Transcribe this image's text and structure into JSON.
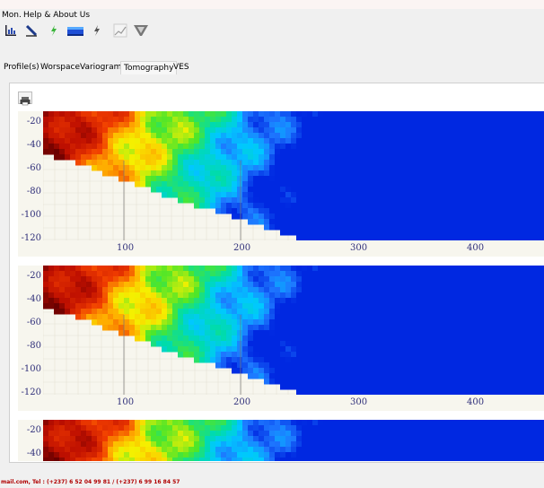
{
  "menu": {
    "items": [
      "Mon.",
      "Help & About Us"
    ]
  },
  "toolbar": {
    "icons": [
      "bar-chart-icon",
      "ruler-icon",
      "lightning-green-icon",
      "block-model-icon",
      "lightning-icon",
      "line-graph-icon",
      "funnel-icon"
    ]
  },
  "tabs": [
    "Profile(s)",
    "Worspace",
    "Variograms",
    "Tomography",
    "VES"
  ],
  "active_tab": "Tomography",
  "footer": {
    "text": "mail.com, Tel : (+237) 6 52 04 99 81 / (+237) 6 99 16 84 57"
  },
  "chart_data": [
    {
      "type": "heatmap",
      "yticks": [
        "-20",
        "-40",
        "-60",
        "-80",
        "-100",
        "-120"
      ],
      "xticks": [
        "100",
        "200",
        "300",
        "400"
      ]
    },
    {
      "type": "heatmap",
      "yticks": [
        "-20",
        "-40",
        "-60",
        "-80",
        "-100",
        "-120"
      ],
      "xticks": [
        "100",
        "200",
        "300",
        "400"
      ]
    },
    {
      "type": "heatmap",
      "yticks": [
        "-20",
        "-40"
      ],
      "xticks": []
    }
  ]
}
